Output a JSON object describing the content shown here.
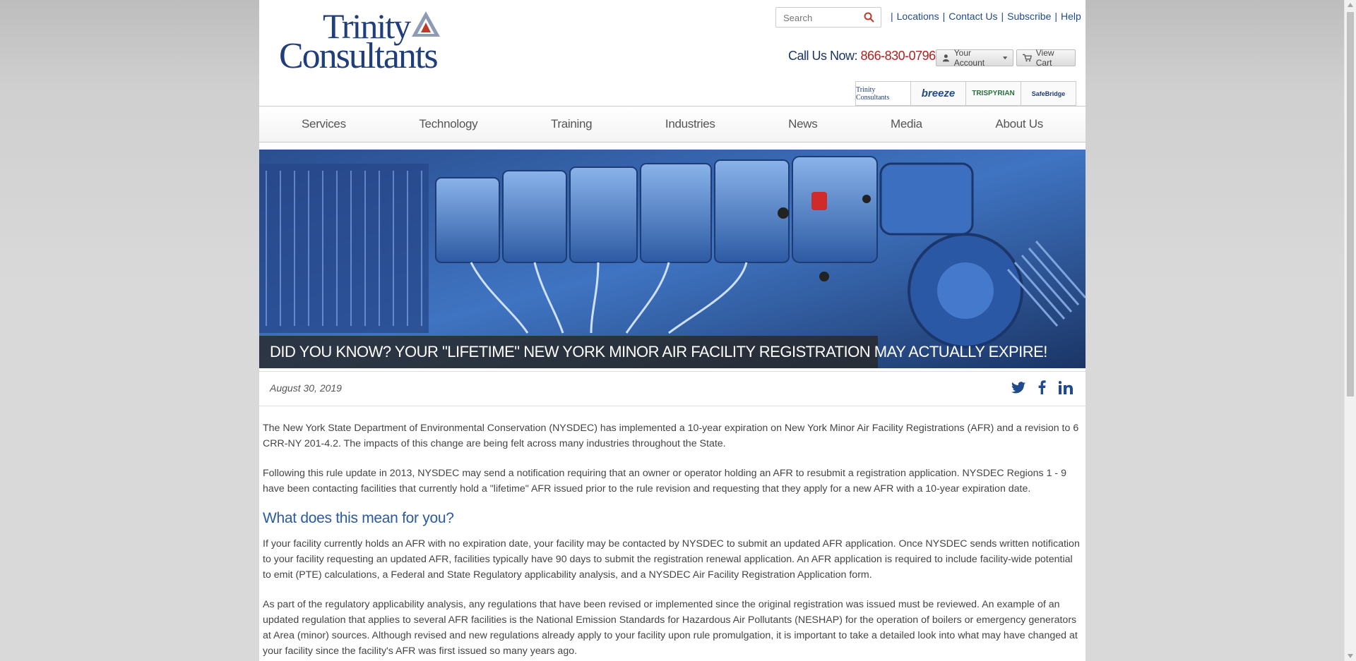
{
  "logo": {
    "line1": "Trinity",
    "line2": "Consultants"
  },
  "search": {
    "placeholder": "Search"
  },
  "top_links": [
    "Locations",
    "Contact Us",
    "Subscribe",
    "Help"
  ],
  "call": {
    "label": "Call Us Now:",
    "phone": "866-830-0796"
  },
  "account": {
    "label": "Your Account"
  },
  "cart": {
    "label": "View Cart"
  },
  "brands": [
    "Trinity Consultants",
    "breeze",
    "TRISPYRIAN",
    "SafeBridge"
  ],
  "nav": [
    "Services",
    "Technology",
    "Training",
    "Industries",
    "News",
    "Media",
    "About Us"
  ],
  "hero": {
    "caption": "DID YOU KNOW? YOUR \"LIFETIME\" NEW YORK MINOR AIR FACILITY REGISTRATION MAY ACTUALLY EXPIRE!"
  },
  "meta": {
    "date": "August 30, 2019"
  },
  "article": {
    "p1": "The New York State Department of Environmental Conservation (NYSDEC) has implemented a 10-year expiration on New York Minor Air Facility Registrations (AFR) and a revision to 6 CRR-NY 201-4.2. The impacts of this change are being felt across many industries throughout the State.",
    "p2": "Following this rule update in 2013, NYSDEC may send a notification requiring that an owner or operator holding an AFR to resubmit a registration application. NYSDEC Regions 1 - 9 have been contacting facilities that currently hold a \"lifetime\" AFR issued prior to the rule revision and requesting that they apply for a new AFR with a 10-year expiration date.",
    "h2": "What does this mean for you?",
    "p3": "If your facility currently holds an AFR with no expiration date, your facility may be contacted by NYSDEC to submit an updated AFR application. Once NYSDEC sends written notification to your facility requesting an updated AFR, facilities typically have 90 days to submit the registration renewal application. An AFR application is required to include facility-wide potential to emit (PTE) calculations, a Federal and State Regulatory applicability analysis, and a NYSDEC Air Facility Registration Application form.",
    "p4": "As part of the regulatory applicability analysis, any regulations that have been revised or implemented since the original registration was issued must be reviewed. An example of an updated regulation that applies to several AFR facilities is the National Emission Standards for Hazardous Air Pollutants (NESHAP) for the operation of boilers or emergency generators at Area (minor) sources. Although revised and new regulations already apply to your facility upon rule promulgation, it is important to take a detailed look into what may have changed at your facility since the facility's AFR was first issued so many years ago."
  },
  "colors": {
    "brand_blue": "#1f3e7a",
    "link_blue": "#1f4b8e",
    "phone_red": "#b32020",
    "heading_blue": "#2a5aa0"
  }
}
